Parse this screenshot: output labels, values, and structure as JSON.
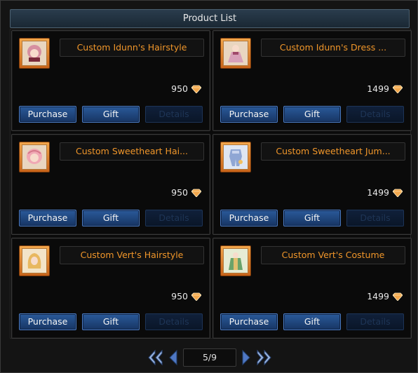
{
  "window": {
    "title": "Product List"
  },
  "products": [
    {
      "name": "Custom Idunn's Hairstyle",
      "price": "950",
      "icon": "hairstyle-icon",
      "purchase_label": "Purchase",
      "gift_label": "Gift",
      "details_label": "Details"
    },
    {
      "name": "Custom Idunn's Dress ...",
      "price": "1499",
      "icon": "dress-icon",
      "purchase_label": "Purchase",
      "gift_label": "Gift",
      "details_label": "Details"
    },
    {
      "name": "Custom Sweetheart Hai...",
      "price": "950",
      "icon": "hairstyle-icon",
      "purchase_label": "Purchase",
      "gift_label": "Gift",
      "details_label": "Details"
    },
    {
      "name": "Custom Sweetheart Jum...",
      "price": "1499",
      "icon": "jumpsuit-icon",
      "purchase_label": "Purchase",
      "gift_label": "Gift",
      "details_label": "Details"
    },
    {
      "name": "Custom Vert's Hairstyle",
      "price": "950",
      "icon": "hairstyle-icon",
      "purchase_label": "Purchase",
      "gift_label": "Gift",
      "details_label": "Details"
    },
    {
      "name": "Custom Vert's Costume",
      "price": "1499",
      "icon": "costume-icon",
      "purchase_label": "Purchase",
      "gift_label": "Gift",
      "details_label": "Details"
    }
  ],
  "pagination": {
    "page_label": "5/9"
  },
  "colors": {
    "accent_orange": "#f0962a",
    "button_blue": "#2a5a9a",
    "gem": "#f3a74c"
  }
}
